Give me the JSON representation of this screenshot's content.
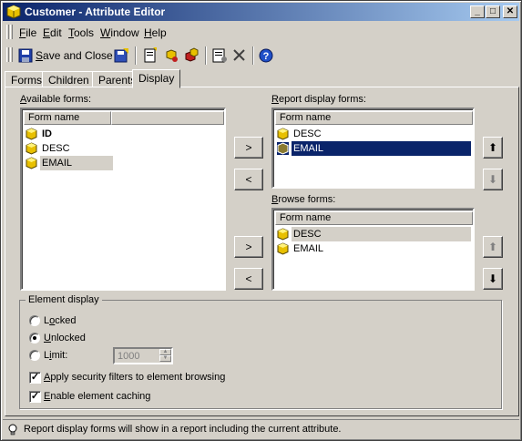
{
  "window": {
    "title": "Customer - Attribute Editor"
  },
  "title_buttons": {
    "minimize": "_",
    "maximize": "□",
    "close": "✕"
  },
  "menu": {
    "file": {
      "key": "F",
      "rest": "ile"
    },
    "edit": {
      "key": "E",
      "rest": "dit"
    },
    "tools": {
      "key": "T",
      "rest": "ools"
    },
    "window": {
      "key": "W",
      "rest": "indow"
    },
    "help": {
      "key": "H",
      "rest": "elp"
    }
  },
  "toolbar": {
    "save_close": {
      "key": "S",
      "rest": "ave and Close"
    }
  },
  "tabs": [
    "Forms",
    "Children",
    "Parents",
    "Display"
  ],
  "display": {
    "available": {
      "label_key": "A",
      "label_rest": "vailable forms:",
      "header": "Form name",
      "items": [
        "ID",
        "DESC",
        "EMAIL"
      ]
    },
    "report": {
      "label_key": "R",
      "label_rest": "eport display forms:",
      "header": "Form name",
      "items": [
        "DESC",
        "EMAIL"
      ]
    },
    "browse": {
      "label_key": "B",
      "label_rest": "rowse forms:",
      "header": "Form name",
      "items": [
        "DESC",
        "EMAIL"
      ]
    },
    "buttons": {
      "add": ">",
      "remove": "<",
      "up": "⬆",
      "down": "⬇"
    }
  },
  "element_display": {
    "legend": "Element display",
    "locked": {
      "key": "o",
      "pre": "L",
      "rest": "cked",
      "checked": false
    },
    "unlocked": {
      "key": "U",
      "pre": "",
      "rest": "nlocked",
      "checked": true
    },
    "limit": {
      "key": "i",
      "pre": "L",
      "rest": "mit:",
      "checked": false,
      "value": "1000"
    },
    "security": {
      "key": "A",
      "pre": "",
      "rest": "pply security filters to element browsing",
      "checked": true
    },
    "caching": {
      "key": "E",
      "pre": "",
      "rest": "nable element caching",
      "checked": true
    }
  },
  "status": {
    "text": "Report display forms will show in a report including the current attribute."
  },
  "colors": {
    "title_start": "#0a246a",
    "title_end": "#a6caf0",
    "selection": "#0a246a",
    "face": "#d4d0c8"
  }
}
